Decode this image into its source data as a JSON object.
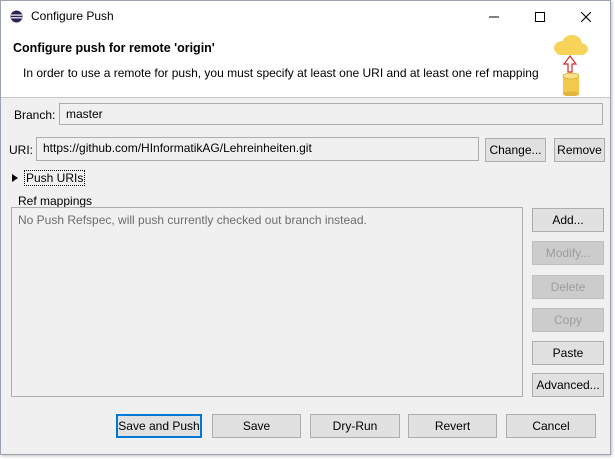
{
  "window": {
    "title": "Configure Push"
  },
  "header": {
    "title": "Configure push for remote 'origin'",
    "description": "In order to use a remote for push, you must specify at least one URI and at least one ref mapping"
  },
  "branch": {
    "label": "Branch:",
    "value": "master"
  },
  "uri": {
    "label": "URI:",
    "value": "https://github.com/HInformatikAG/Lehreinheiten.git",
    "change_label": "Change...",
    "remove_label": "Remove"
  },
  "push_uris": {
    "label": "Push URIs"
  },
  "ref_mappings": {
    "label": "Ref mappings",
    "empty_text": "No Push Refspec, will push currently checked out branch instead.",
    "buttons": {
      "add": "Add...",
      "modify": "Modify...",
      "delete": "Delete",
      "copy": "Copy",
      "paste": "Paste",
      "advanced": "Advanced..."
    }
  },
  "footer": {
    "save_and_push": "Save and Push",
    "save": "Save",
    "dry_run": "Dry-Run",
    "revert": "Revert",
    "cancel": "Cancel"
  },
  "colors": {
    "accent": "#0078d7",
    "window_bg": "#f0f0f0",
    "disabled_text": "#9d9d9d"
  }
}
